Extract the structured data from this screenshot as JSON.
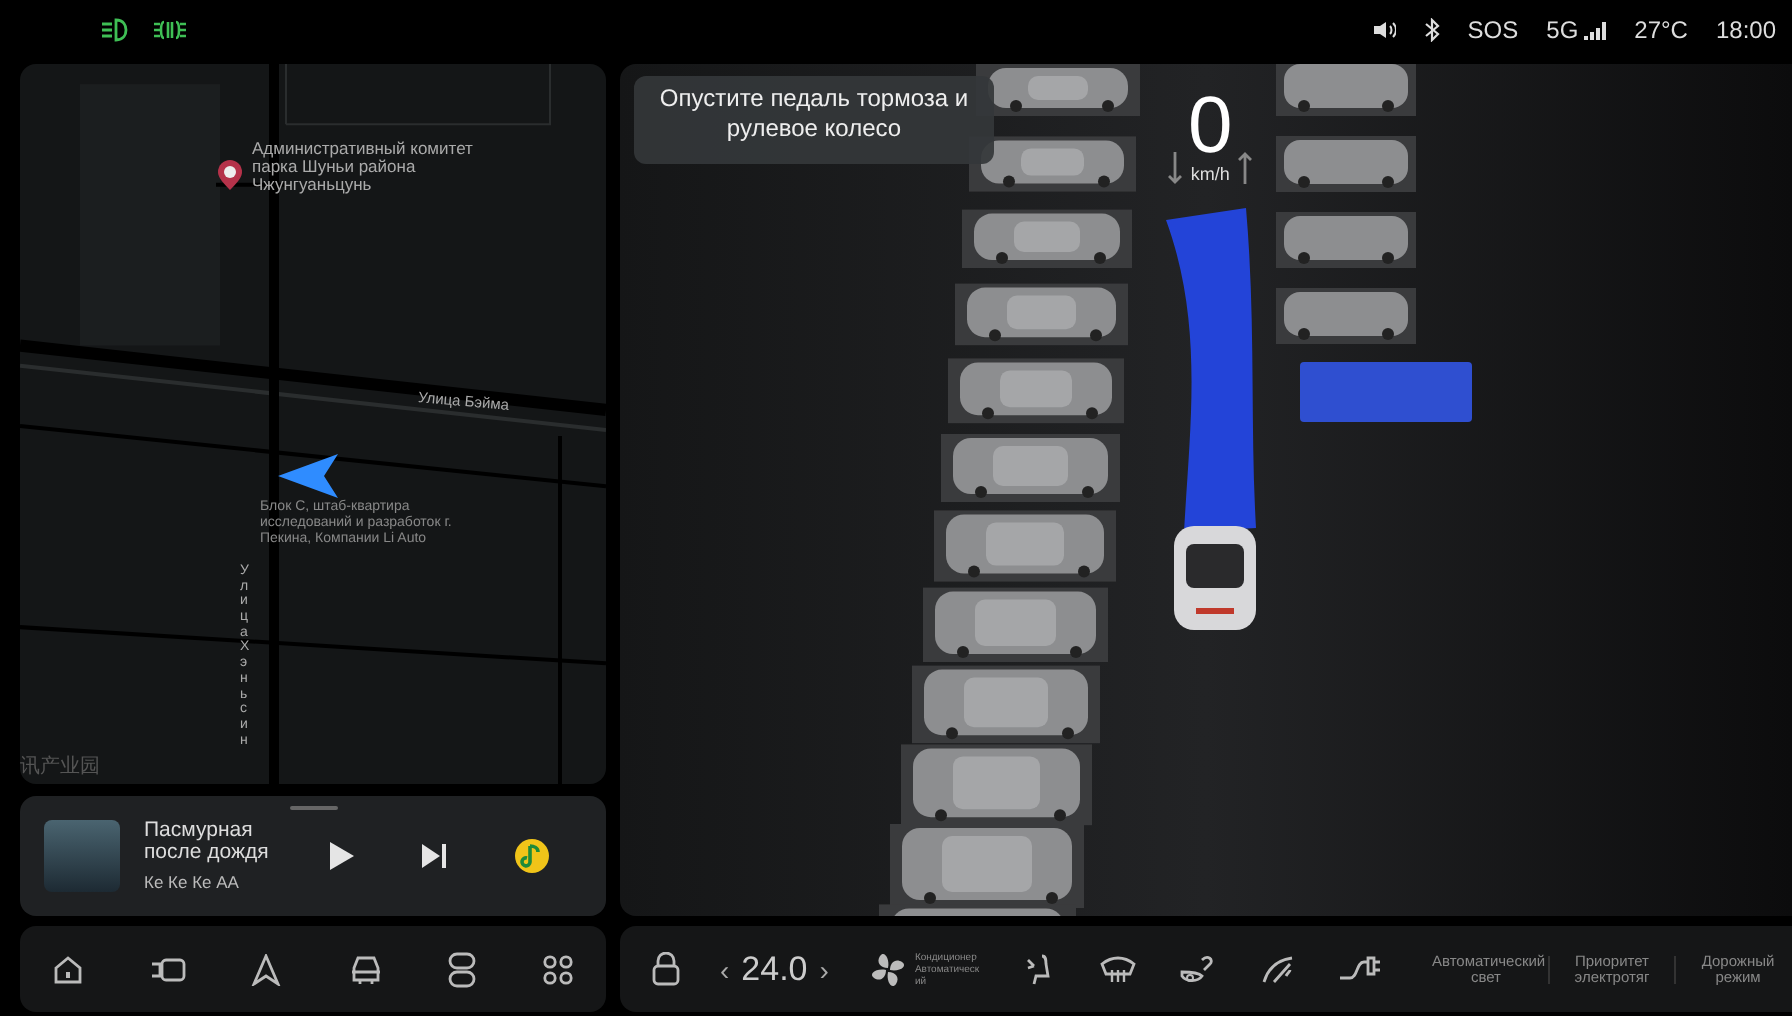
{
  "status_bar": {
    "left_indicators": [
      {
        "kind": "headlight"
      },
      {
        "kind": "parking_light"
      }
    ],
    "sos": "SOS",
    "network": "5G",
    "temperature": "27°C",
    "time": "18:00"
  },
  "map": {
    "poi": "Административный комитет парка Шуньи района Чжунгуаньцунь",
    "street_horizontal": "Улица Бэйма",
    "street_vertical": "УлицаХэньсин",
    "location": "Блок C, штаб-квартира исследований и разработок г. Пекина, Компании Li Auto",
    "area_label": "讯产业园"
  },
  "media": {
    "title": "Пасмурная после дождя",
    "artist": "Ке Ке Ке АА"
  },
  "dock": [
    {
      "kind": "home"
    },
    {
      "kind": "camera"
    },
    {
      "kind": "navigation"
    },
    {
      "kind": "car"
    },
    {
      "kind": "toggle"
    },
    {
      "kind": "apps"
    }
  ],
  "parking": {
    "notice": "Опустите педаль тормоза и рулевое колесо",
    "speed": "0",
    "speed_unit": "km/h"
  },
  "climate": {
    "prev": "‹",
    "temperature": "24.0",
    "next": "›",
    "ac_label": "Кондиционер Автоматический"
  },
  "controls": [
    {
      "kind": "seat"
    },
    {
      "kind": "defrost"
    },
    {
      "kind": "mirror"
    },
    {
      "kind": "wiper"
    },
    {
      "kind": "plug"
    }
  ],
  "quick_settings": [
    "Автоматический свет",
    "Приоритет электротяг",
    "Дорожный режим"
  ]
}
